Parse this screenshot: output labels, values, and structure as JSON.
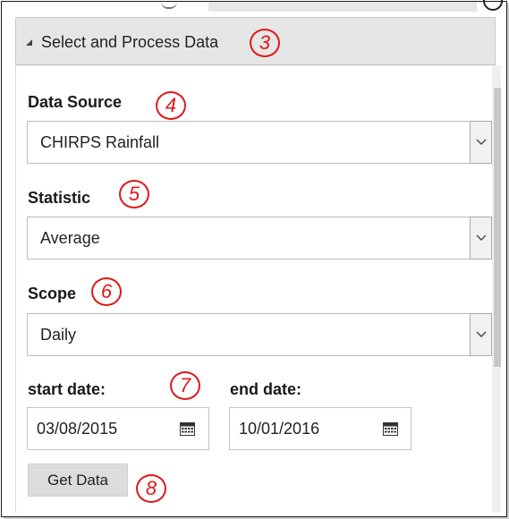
{
  "section": {
    "title": "Select and Process Data"
  },
  "data_source": {
    "label": "Data Source",
    "value": "CHIRPS Rainfall"
  },
  "statistic": {
    "label": "Statistic",
    "value": "Average"
  },
  "scope": {
    "label": "Scope",
    "value": "Daily"
  },
  "start_date": {
    "label": "start date:",
    "value": "03/08/2015"
  },
  "end_date": {
    "label": "end date:",
    "value": "10/01/2016"
  },
  "get_data_button": "Get Data",
  "annotations": [
    "3",
    "4",
    "5",
    "6",
    "7",
    "8"
  ],
  "colors": {
    "annotation": "#e01818",
    "header_bg": "#e6e6e6",
    "button_bg": "#dcdcdc"
  },
  "icons": [
    "triangle-expand-icon",
    "chevron-down-icon",
    "calendar-icon"
  ]
}
